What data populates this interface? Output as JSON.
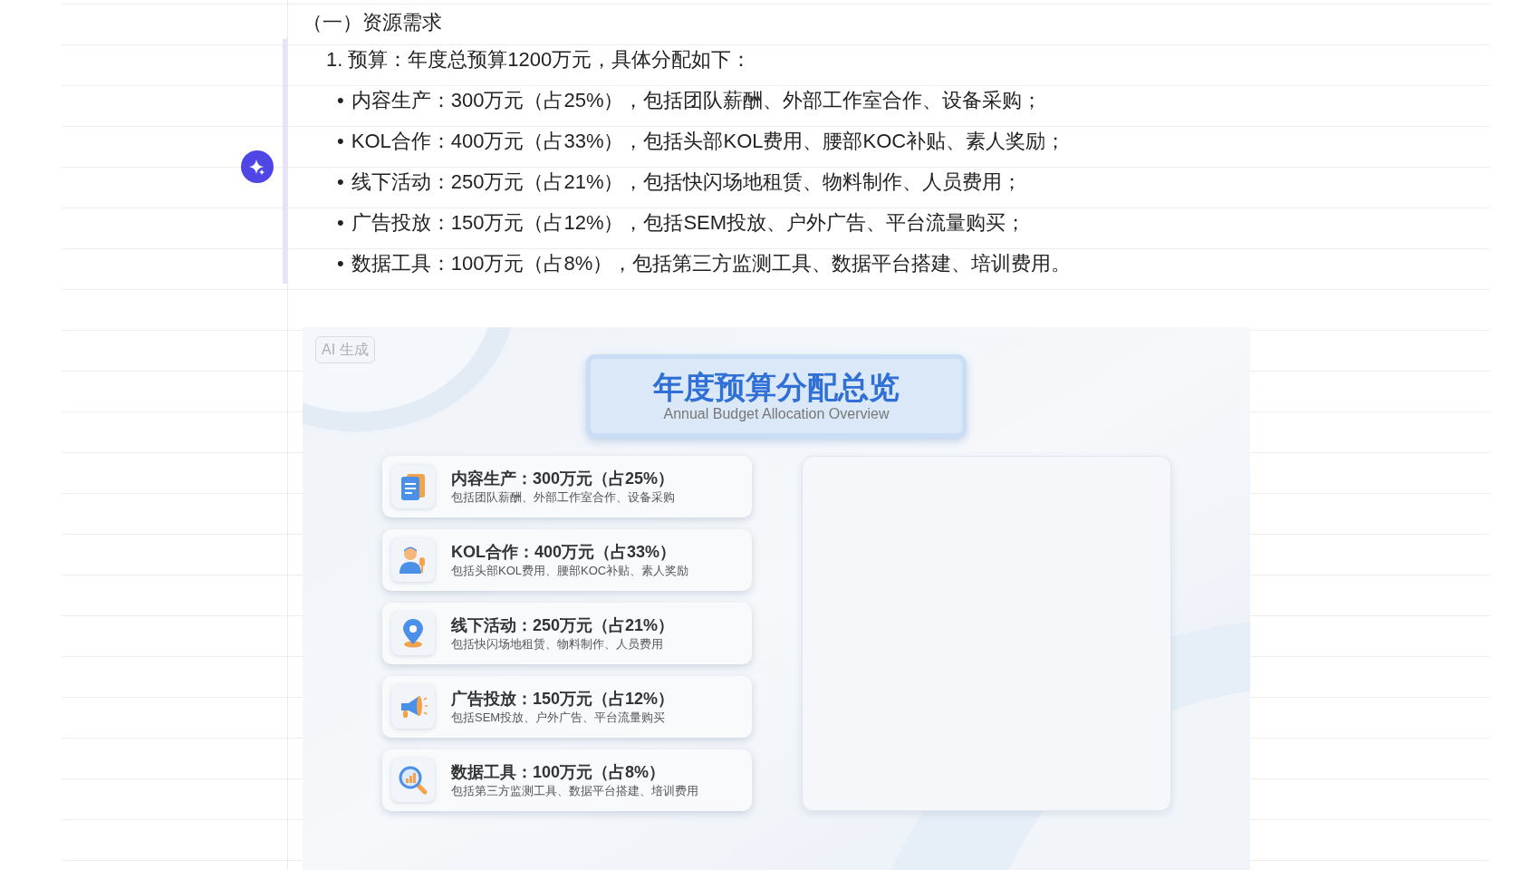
{
  "section_heading": "（一）资源需求",
  "list_item": {
    "number": "1.",
    "text": "预算：年度总预算1200万元，具体分配如下："
  },
  "bullets": [
    {
      "marker": "•",
      "text": "内容生产：300万元（占25%），包括团队薪酬、外部工作室合作、设备采购；"
    },
    {
      "marker": "•",
      "text": "KOL合作：400万元（占33%），包括头部KOL费用、腰部KOC补贴、素人奖励；"
    },
    {
      "marker": "•",
      "text": "线下活动：250万元（占21%），包括快闪场地租赁、物料制作、人员费用；"
    },
    {
      "marker": "•",
      "text": "广告投放：150万元（占12%），包括SEM投放、户外广告、平台流量购买；"
    },
    {
      "marker": "•",
      "text": "数据工具：100万元（占8%），包括第三方监测工具、数据平台搭建、培训费用。"
    }
  ],
  "image": {
    "badge": "AI 生成",
    "title": "年度预算分配总览",
    "subtitle": "Annual Budget Allocation Overview",
    "cards": [
      {
        "title": "内容生产：300万元（占25%）",
        "description": "包括团队薪酬、外部工作室合作、设备采购"
      },
      {
        "title": "KOL合作：400万元（占33%）",
        "description": "包括头部KOL费用、腰部KOC补贴、素人奖励"
      },
      {
        "title": "线下活动：250万元（占21%）",
        "description": "包括快闪场地租赁、物料制作、人员费用"
      },
      {
        "title": "广告投放：150万元（占12%）",
        "description": "包括SEM投放、户外广告、平台流量购买"
      },
      {
        "title": "数据工具：100万元（占8%）",
        "description": "包括第三方监测工具、数据平台搭建、培训费用"
      }
    ]
  }
}
